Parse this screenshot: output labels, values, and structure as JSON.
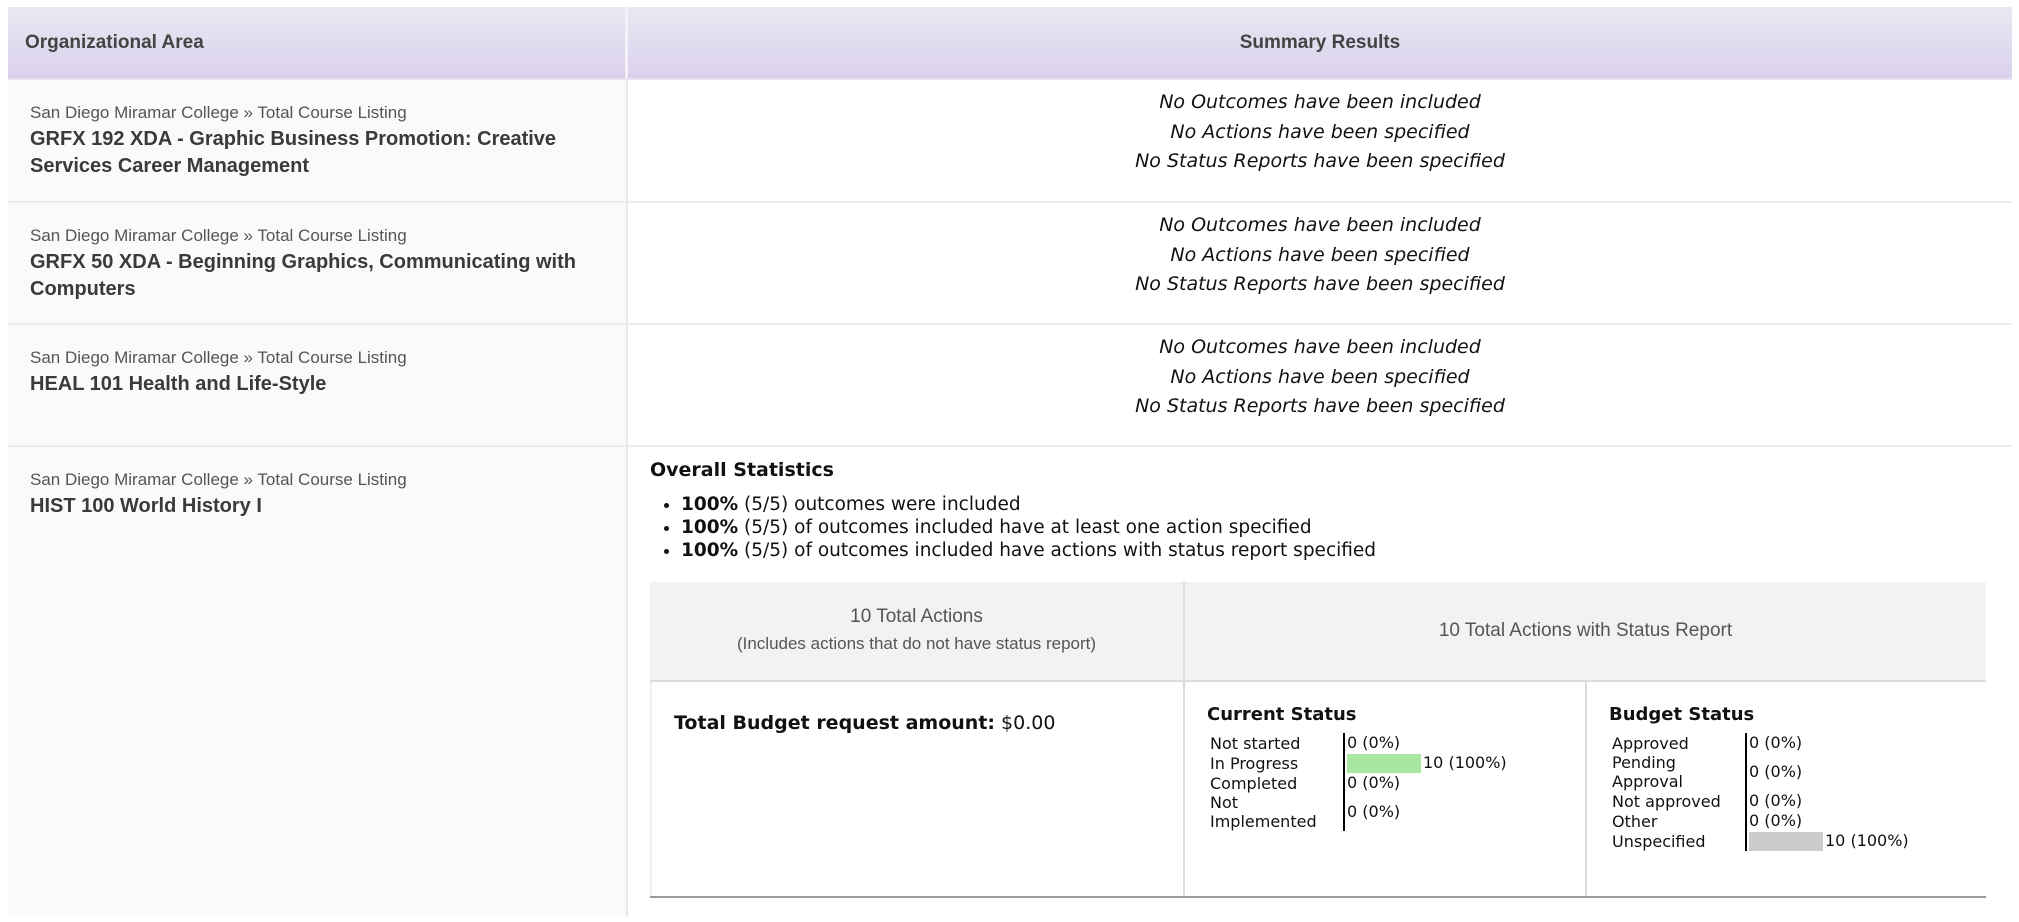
{
  "header": {
    "left": "Organizational Area",
    "right": "Summary Results"
  },
  "rows": [
    {
      "crumb": "San Diego Miramar College » Total Course Listing",
      "course": "GRFX 192 XDA - Graphic Business Promotion: Creative Services Career Management",
      "summary": [
        "No Outcomes have been included",
        "No Actions have been specified",
        "No Status Reports have been specified"
      ]
    },
    {
      "crumb": "San Diego Miramar College » Total Course Listing",
      "course": "GRFX 50 XDA - Beginning Graphics, Communicating with Computers",
      "summary": [
        "No Outcomes have been included",
        "No Actions have been specified",
        "No Status Reports have been specified"
      ]
    },
    {
      "crumb": "San Diego Miramar College » Total Course Listing",
      "course": "HEAL 101 Health and Life-Style",
      "summary": [
        "No Outcomes have been included",
        "No Actions have been specified",
        "No Status Reports have been specified"
      ]
    },
    {
      "crumb": "San Diego Miramar College » Total Course Listing",
      "course": "HIST 100 World History I"
    }
  ],
  "overall": {
    "title": "Overall Statistics",
    "items": [
      {
        "pct": "100%",
        "text": " (5/5) outcomes were included"
      },
      {
        "pct": "100%",
        "text": " (5/5) of outcomes included have at least one action specified"
      },
      {
        "pct": "100%",
        "text": " (5/5) of outcomes included have actions with status report specified"
      }
    ],
    "total_actions": "10 Total Actions",
    "total_actions_note": "(Includes actions that do not have status report)",
    "total_with_status": "10 Total Actions with Status Report",
    "budget_label": "Total Budget request amount:",
    "budget_value": " $0.00",
    "current_status": {
      "title": "Current Status",
      "color": "#a8e6a1",
      "rows": [
        {
          "label": "Not started",
          "value": "0 (0%)",
          "fraction": 0
        },
        {
          "label": "In Progress",
          "value": "10 (100%)",
          "fraction": 1
        },
        {
          "label": "Completed",
          "value": "0 (0%)",
          "fraction": 0
        },
        {
          "label": "Not Implemented",
          "value": "0 (0%)",
          "fraction": 0
        }
      ]
    },
    "budget_status": {
      "title": "Budget Status",
      "color": "#cccccc",
      "rows": [
        {
          "label": "Approved",
          "value": "0 (0%)",
          "fraction": 0
        },
        {
          "label": "Pending Approval",
          "value": "0 (0%)",
          "fraction": 0
        },
        {
          "label": "Not approved",
          "value": "0 (0%)",
          "fraction": 0
        },
        {
          "label": "Other",
          "value": "0 (0%)",
          "fraction": 0
        },
        {
          "label": "Unspecified",
          "value": "10 (100%)",
          "fraction": 1
        }
      ]
    }
  }
}
